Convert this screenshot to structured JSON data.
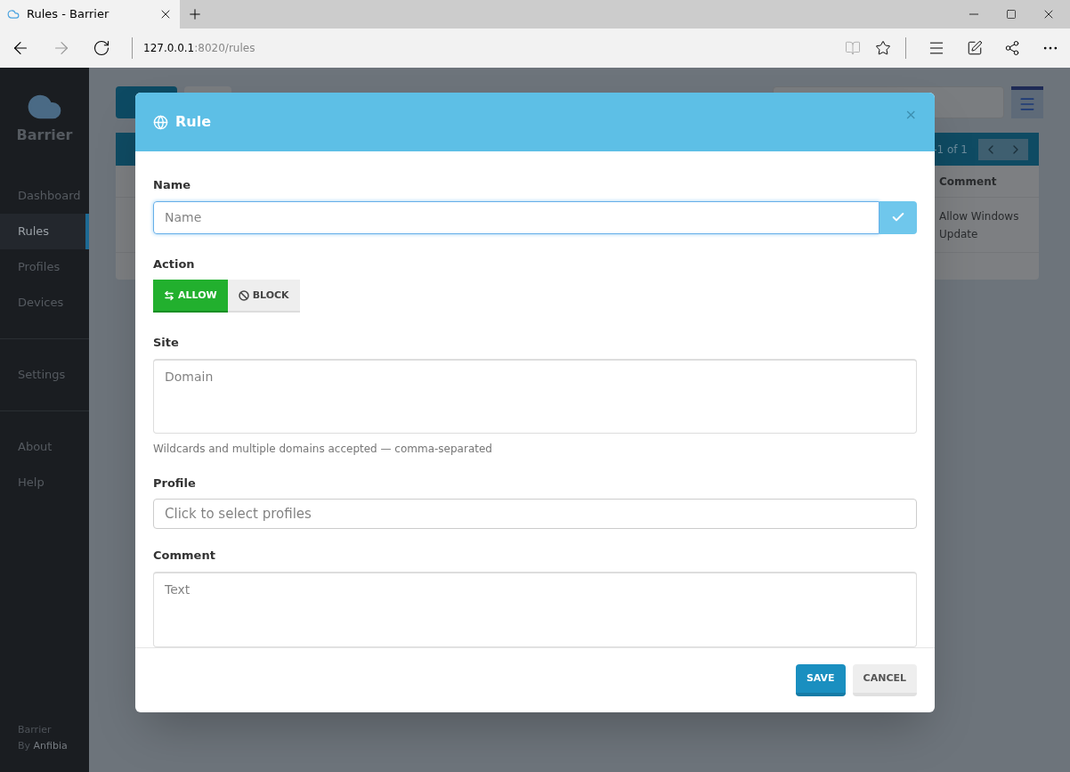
{
  "browser": {
    "tab_title": "Rules - Barrier",
    "address_host": "127.0.0.1",
    "address_rest": ":8020/rules"
  },
  "sidebar": {
    "brand": "Barrier",
    "groups": [
      [
        {
          "label": "Dashboard",
          "selected": false
        },
        {
          "label": "Rules",
          "selected": true
        },
        {
          "label": "Profiles",
          "selected": false
        },
        {
          "label": "Devices",
          "selected": false
        }
      ],
      [
        {
          "label": "Settings",
          "selected": false
        }
      ],
      [
        {
          "label": "About",
          "selected": false
        },
        {
          "label": "Help",
          "selected": false
        }
      ]
    ],
    "footer_name": "Barrier",
    "footer_by": "By",
    "footer_author": "Anfibia"
  },
  "background": {
    "pagination": "-1 of 1",
    "column": "Comment",
    "rows": [
      {
        "comment": "Allow Windows Update"
      }
    ]
  },
  "modal": {
    "title": "Rule",
    "close": "×",
    "name": {
      "label": "Name",
      "placeholder": "Name"
    },
    "action": {
      "label": "Action",
      "options": [
        {
          "kind": "allow",
          "label": "ALLOW",
          "selected": true
        },
        {
          "kind": "block",
          "label": "BLOCK",
          "selected": false
        }
      ]
    },
    "site": {
      "label": "Site",
      "placeholder": "Domain",
      "help": "Wildcards and multiple domains accepted — comma-separated"
    },
    "profile": {
      "label": "Profile",
      "placeholder": "Click to select profiles"
    },
    "comment": {
      "label": "Comment",
      "placeholder": "Text"
    },
    "buttons": [
      {
        "kind": "primary",
        "label": "SAVE"
      },
      {
        "kind": "default",
        "label": "CANCEL"
      }
    ]
  }
}
